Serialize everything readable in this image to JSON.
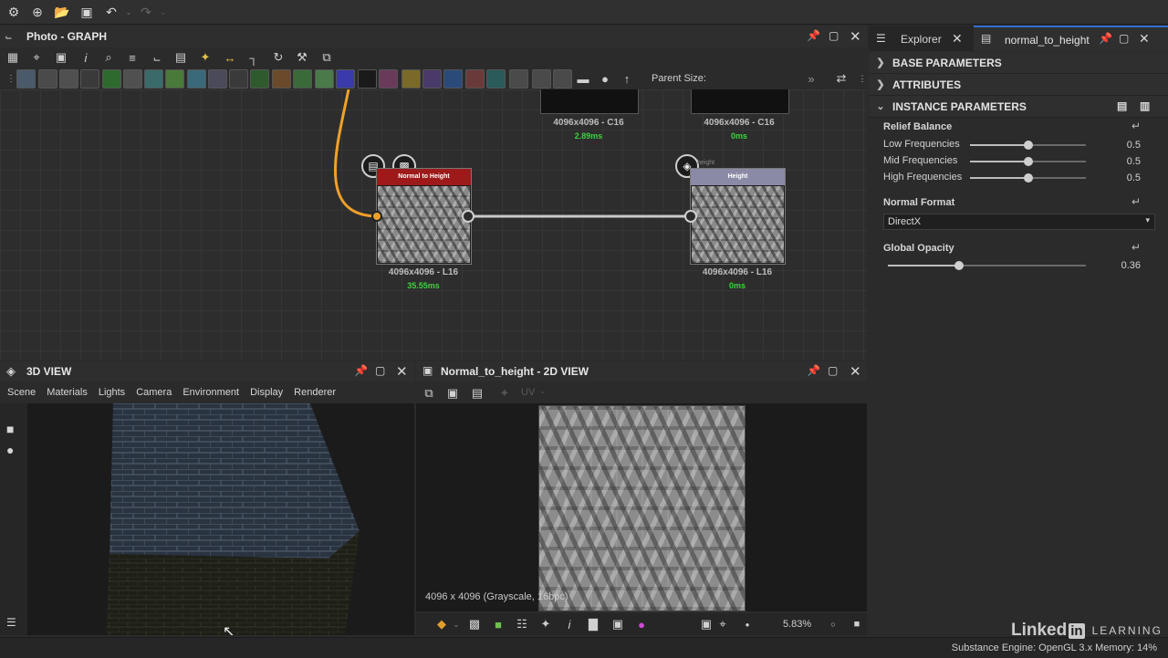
{
  "app_toolbar": {
    "icons": [
      "substance-logo-icon",
      "new-package-icon",
      "open-folder-icon",
      "save-icon",
      "undo-icon",
      "dropdown-icon",
      "redo-icon",
      "dropdown-icon"
    ]
  },
  "graph_panel": {
    "title": "Photo - GRAPH",
    "parent_size_label": "Parent Size:",
    "nodes": {
      "top_left": {
        "resolution": "4096x4096 - C16",
        "time": "2.89ms"
      },
      "top_right": {
        "resolution": "4096x4096 - C16",
        "time": "0ms"
      },
      "normal_to_height": {
        "header": "Normal to Height",
        "resolution": "4096x4096 - L16",
        "time": "35.55ms"
      },
      "height_output": {
        "header": "Height",
        "tag": "height",
        "resolution": "4096x4096 - L16",
        "time": "0ms"
      }
    }
  },
  "right_panel": {
    "tabs": [
      {
        "label": "Explorer"
      },
      {
        "label": "normal_to_height"
      }
    ],
    "sections": {
      "base": "BASE PARAMETERS",
      "attributes": "ATTRIBUTES",
      "instance": "INSTANCE PARAMETERS"
    },
    "relief_balance": {
      "title": "Relief Balance",
      "params": [
        {
          "label": "Low Frequencies",
          "value": "0.5",
          "level": 0.5
        },
        {
          "label": "Mid Frequencies",
          "value": "0.5",
          "level": 0.5
        },
        {
          "label": "High Frequencies",
          "value": "0.5",
          "level": 0.5
        }
      ]
    },
    "normal_format": {
      "title": "Normal Format",
      "selected": "DirectX"
    },
    "global_opacity": {
      "title": "Global Opacity",
      "value": "0.36",
      "level": 0.36
    }
  },
  "view3d": {
    "title": "3D VIEW",
    "menu": [
      "Scene",
      "Materials",
      "Lights",
      "Camera",
      "Environment",
      "Display",
      "Renderer"
    ]
  },
  "view2d": {
    "title": "Normal_to_height - 2D VIEW",
    "uv_label": "UV",
    "info": "4096 x 4096 (Grayscale, 16bpc)",
    "zoom": "5.83%"
  },
  "status_bar": {
    "text": "Substance Engine: OpenGL 3.x  Memory: 14%"
  },
  "watermark": {
    "brand": "Linked",
    "brand_in": "in",
    "learning": "LEARNING"
  },
  "colors": {
    "accent_tab": "#2f6fd0",
    "node_red": "#9e1a1a",
    "node_lilac": "#8a8aa6",
    "time_green": "#3fd13f",
    "wire_orange": "#f0a02a"
  }
}
